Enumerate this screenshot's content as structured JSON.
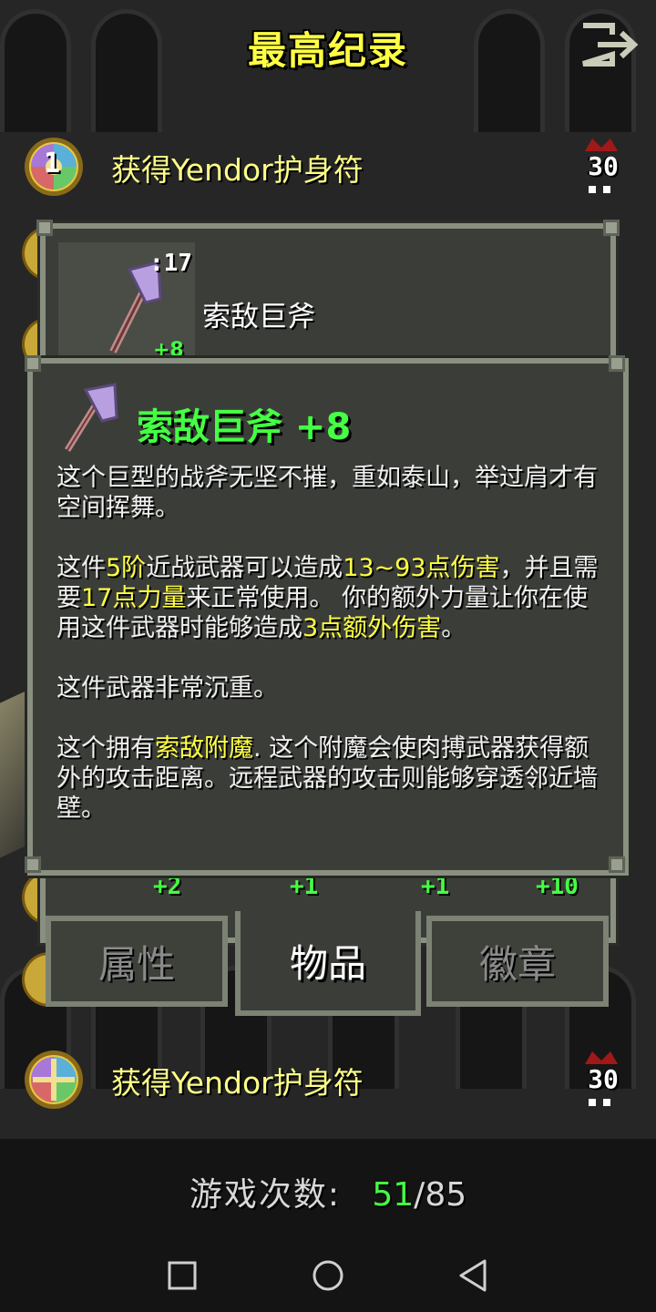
{
  "header": {
    "title": "最高纪录",
    "exit_icon": "exit-icon"
  },
  "records": [
    {
      "rank": "1",
      "text": "获得Yendor护身符",
      "depth": "30"
    },
    {
      "rank": "",
      "text": "获得Yendor护身符",
      "depth": "30"
    }
  ],
  "hero_window": {
    "item_slot": {
      "badge": ":17",
      "name": "索敌巨斧",
      "upgrade_peek": "+8"
    },
    "stat_bonuses": [
      "+2",
      "+1",
      "+1",
      "+10"
    ],
    "tabs": [
      {
        "label": "属性",
        "active": false
      },
      {
        "label": "物品",
        "active": true
      },
      {
        "label": "徽章",
        "active": false
      }
    ]
  },
  "item_info": {
    "title": "索敌巨斧 +8",
    "desc1": "这个巨型的战斧无坚不摧，重如泰山，举过肩才有空间挥舞。",
    "p2": {
      "t1": "这件",
      "tier": "5阶",
      "t2": "近战武器可以造成",
      "damage": "13~93点伤害",
      "t3": "，并且需要",
      "strength": "17点力量",
      "t4": "来正常使用。 你的额外力量让你在使用这件武器时能够造成",
      "bonus": "3点额外伤害",
      "t5": "。"
    },
    "desc3": "这件武器非常沉重。",
    "p4": {
      "t1": "这个拥有",
      "enchant": "索敌附魔",
      "t2": ". 这个附魔会使肉搏武器获得额外的攻击距离。远程武器的攻击则能够穿透邻近墙壁。"
    }
  },
  "footer": {
    "games_label": "游戏次数:",
    "games_won": "51",
    "separator": "/",
    "games_total": "85"
  },
  "colors": {
    "title_yellow": "#ffff44",
    "green": "#44ff44",
    "panel": "#3b3e38",
    "border": "#8a9080"
  }
}
